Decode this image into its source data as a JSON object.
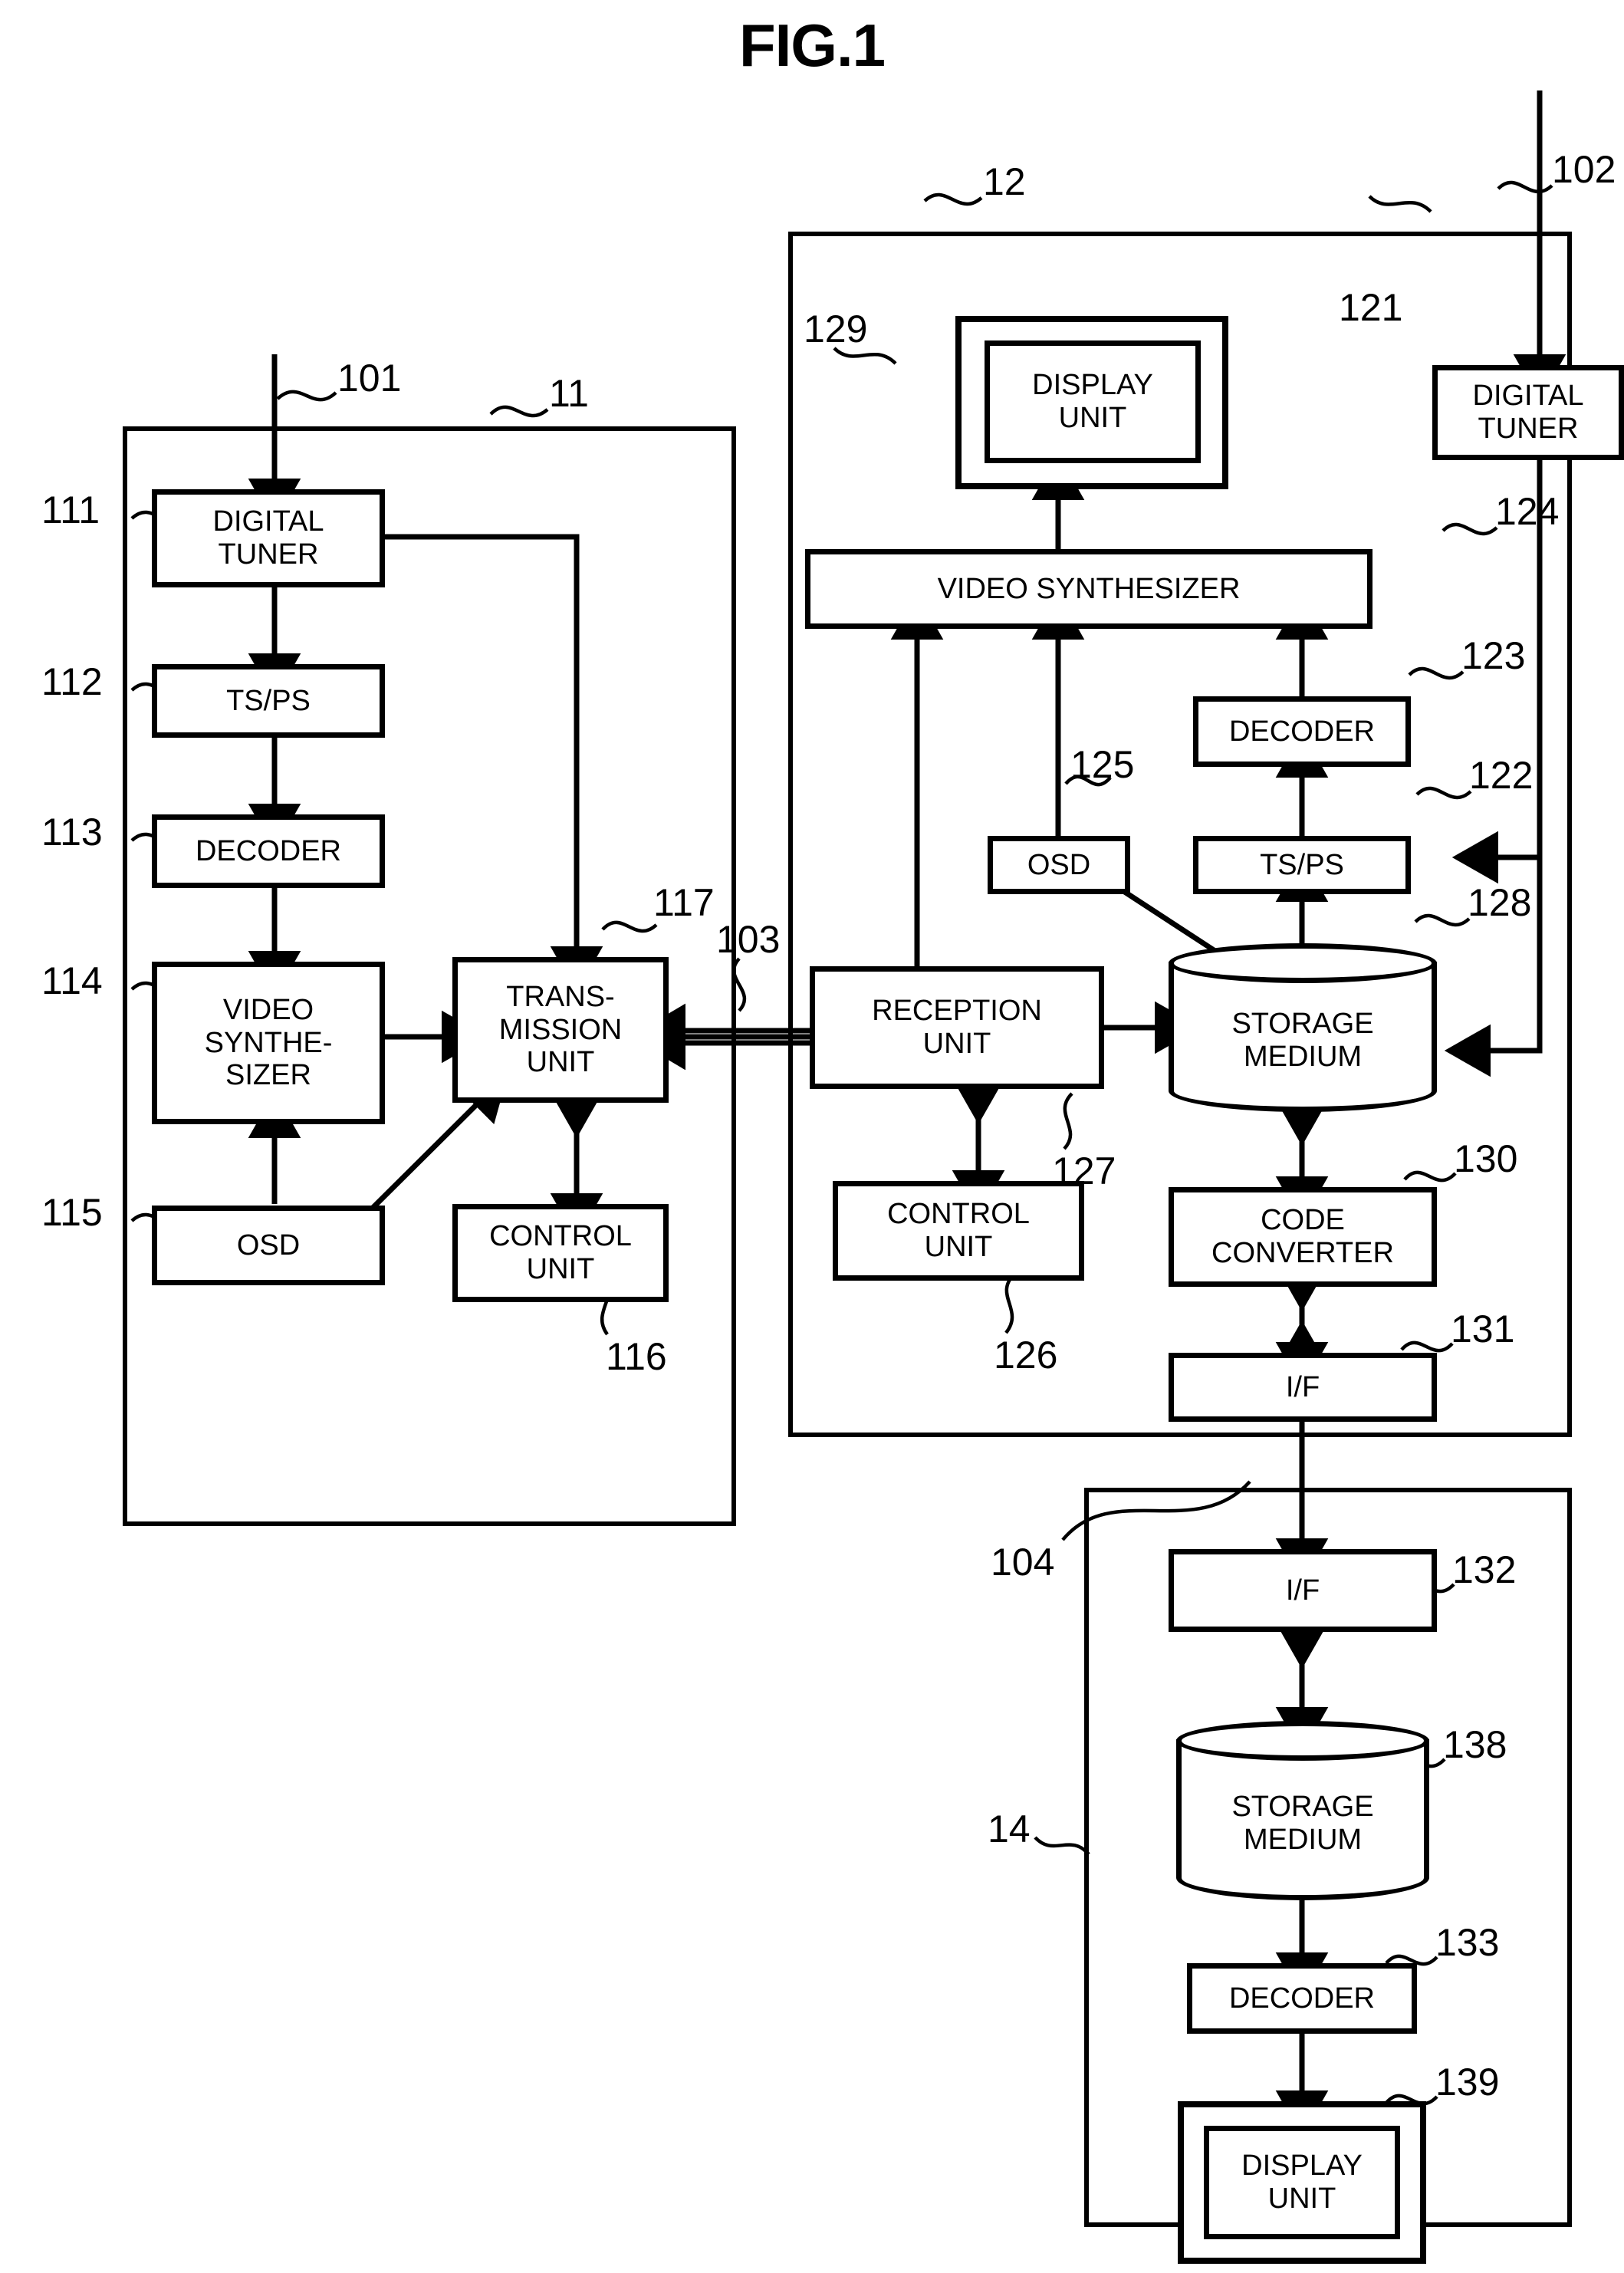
{
  "figure": {
    "title": "FIG.1"
  },
  "blocks": {
    "transmitter": {
      "ref": "11",
      "units": {
        "digital_tuner": {
          "ref": "111",
          "label": "DIGITAL\nTUNER"
        },
        "ts_ps": {
          "ref": "112",
          "label": "TS/PS"
        },
        "decoder": {
          "ref": "113",
          "label": "DECODER"
        },
        "video_synthesizer": {
          "ref": "114",
          "label": "VIDEO\nSYNTHE-\nSIZER"
        },
        "osd": {
          "ref": "115",
          "label": "OSD"
        },
        "control_unit": {
          "ref": "116",
          "label": "CONTROL\nUNIT"
        },
        "transmission_unit": {
          "ref": "117",
          "label": "TRANS-\nMISSION\nUNIT"
        }
      }
    },
    "receiver": {
      "ref": "12",
      "units": {
        "digital_tuner": {
          "ref": "121",
          "label": "DIGITAL\nTUNER"
        },
        "ts_ps": {
          "ref": "122",
          "label": "TS/PS"
        },
        "decoder": {
          "ref": "123",
          "label": "DECODER"
        },
        "video_synthesizer": {
          "ref": "124",
          "label": "VIDEO SYNTHESIZER"
        },
        "osd": {
          "ref": "125",
          "label": "OSD"
        },
        "control_unit": {
          "ref": "126",
          "label": "CONTROL\nUNIT"
        },
        "reception_unit": {
          "ref": "127",
          "label": "RECEPTION\nUNIT"
        },
        "storage_medium": {
          "ref": "128",
          "label": "STORAGE\nMEDIUM"
        },
        "display_unit": {
          "ref": "129",
          "label": "DISPLAY\nUNIT"
        },
        "code_converter": {
          "ref": "130",
          "label": "CODE\nCONVERTER"
        },
        "interface": {
          "ref": "131",
          "label": "I/F"
        }
      }
    },
    "external_device": {
      "ref": "14",
      "units": {
        "interface": {
          "ref": "132",
          "label": "I/F"
        },
        "storage_medium": {
          "ref": "138",
          "label": "STORAGE\nMEDIUM"
        },
        "decoder": {
          "ref": "133",
          "label": "DECODER"
        },
        "display_unit": {
          "ref": "139",
          "label": "DISPLAY\nUNIT"
        }
      }
    }
  },
  "signals": {
    "broadcast_in_transmitter": "101",
    "broadcast_in_receiver": "102",
    "transmission_link": "103",
    "device_link": "104"
  }
}
